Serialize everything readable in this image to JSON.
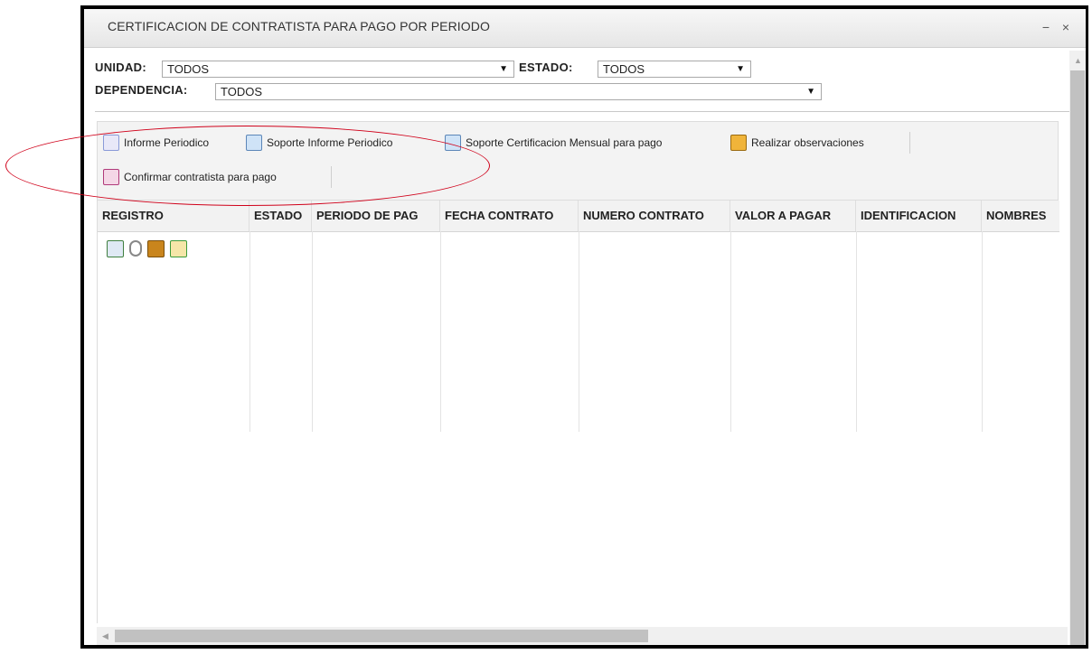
{
  "window": {
    "title": "CERTIFICACION DE CONTRATISTA PARA PAGO POR PERIODO",
    "minimize_glyph": "−",
    "close_glyph": "×"
  },
  "filters": {
    "unidad": {
      "label": "UNIDAD:",
      "value": "TODOS"
    },
    "estado": {
      "label": "ESTADO:",
      "value": "TODOS"
    },
    "dependencia": {
      "label": "DEPENDENCIA:",
      "value": "TODOS"
    }
  },
  "toolbar": {
    "items": [
      {
        "label": "Informe Periodico",
        "icon": "report-icon"
      },
      {
        "label": "Soporte Informe Periodico",
        "icon": "support-icon"
      },
      {
        "label": "Soporte Certificacion Mensual para pago",
        "icon": "support-icon"
      },
      {
        "label": "Realizar observaciones",
        "icon": "observations-icon"
      },
      {
        "label": "Confirmar contratista para pago",
        "icon": "confirm-icon"
      }
    ]
  },
  "grid": {
    "columns": [
      "REGISTRO",
      "ESTADO",
      "PERIODO DE PAG",
      "FECHA CONTRATO",
      "NUMERO CONTRATO",
      "VALOR A PAGAR",
      "IDENTIFICACION",
      "NOMBRES"
    ],
    "row_action_icons": [
      "document-icon",
      "paperclip-icon",
      "folder-icon",
      "checklist-icon"
    ]
  },
  "colors": {
    "annotation_ellipse": "#d0021b",
    "header_bg": "#f2f2f2",
    "border": "#000000"
  },
  "glyphs": {
    "dropdown_arrow": "▼",
    "scroll_up": "▲",
    "scroll_left": "◀"
  }
}
